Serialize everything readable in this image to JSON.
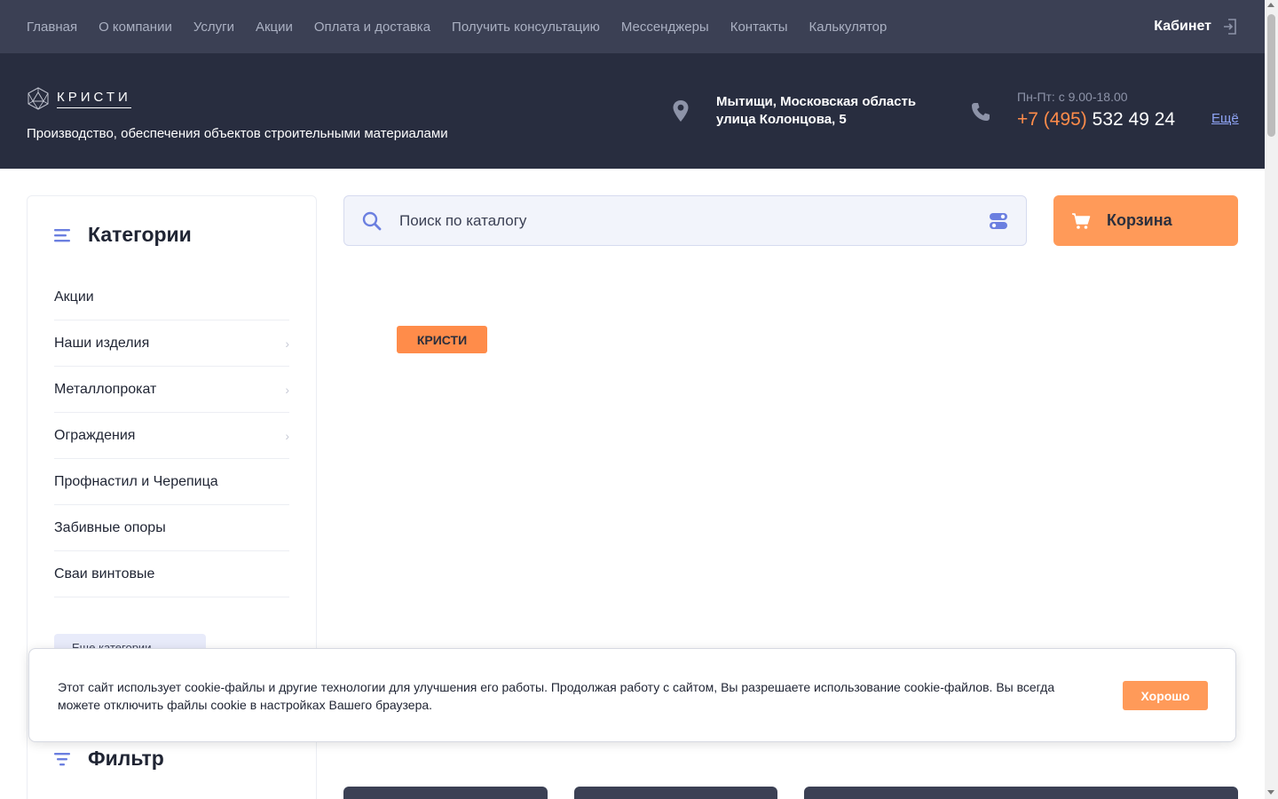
{
  "topnav": {
    "links": [
      "Главная",
      "О компании",
      "Услуги",
      "Акции",
      "Оплата и доставка",
      "Получить консультацию",
      "Мессенджеры",
      "Контакты",
      "Калькулятор"
    ],
    "cabinet_label": "Кабинет",
    "cabinet_icon": "login-icon"
  },
  "header": {
    "logo_text": "КРИСТИ",
    "logo_icon": "polyhedron-logo-icon",
    "tagline": "Производство, обеспечения объектов строительными материалами",
    "address_line1": "Мытищи, Московская область",
    "address_line2": "улица Колонцова, 5",
    "address_icon": "location-pin-icon",
    "hours": "Пн-Пт: с 9.00-18.00",
    "phone_code": "+7 (495)",
    "phone_number": "532 49 24",
    "phone_icon": "phone-icon",
    "more_label": "Ещё"
  },
  "sidebar": {
    "title": "Категории",
    "title_icon": "menu-lines-icon",
    "items": [
      {
        "label": "Акции",
        "has_children": false
      },
      {
        "label": "Наши изделия",
        "has_children": true
      },
      {
        "label": "Металлопрокат",
        "has_children": true
      },
      {
        "label": "Ограждения",
        "has_children": true
      },
      {
        "label": "Профнастил и Черепица",
        "has_children": false
      },
      {
        "label": "Забивные опоры",
        "has_children": false
      },
      {
        "label": "Сваи винтовые",
        "has_children": false
      }
    ],
    "more_categories_label": "Еще категории",
    "filter_title": "Фильтр",
    "filter_icon": "filter-icon"
  },
  "search": {
    "placeholder": "Поиск по каталогу",
    "search_icon": "search-icon",
    "settings_icon": "toggle-settings-icon"
  },
  "cart": {
    "label": "Корзина",
    "icon": "cart-icon"
  },
  "brand_tag": "КРИСТИ",
  "cookie": {
    "text": "Этот сайт использует cookie-файлы и другие технологии для улучшения его работы. Продолжая работу с сайтом, Вы разрешаете использование cookie-файлов. Вы всегда можете отключить файлы cookie в настройках Вашего браузера.",
    "button_label": "Хорошо"
  },
  "colors": {
    "accent": "#ff9a59",
    "nav_bg": "#3b4054",
    "header_bg": "#282d3f",
    "link": "#8fa4f5"
  }
}
